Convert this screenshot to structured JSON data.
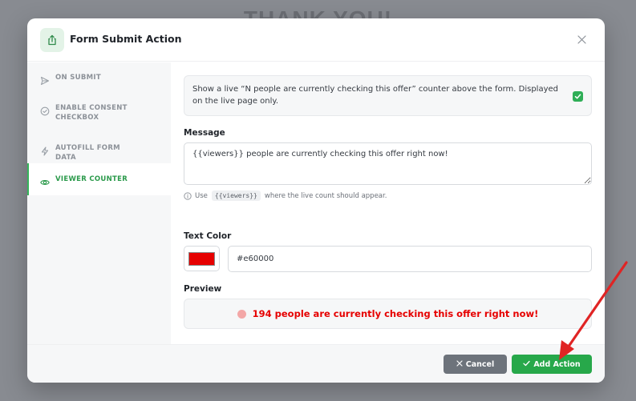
{
  "background": {
    "title": "THANK YOU!"
  },
  "modal": {
    "title": "Form Submit Action",
    "header_icon": "share-upload-icon",
    "close_icon": "close-icon"
  },
  "sidebar": {
    "items": [
      {
        "label": "On Submit",
        "icon": "send-icon",
        "active": false
      },
      {
        "label": "Enable Consent Checkbox",
        "icon": "check-circle-icon",
        "active": false
      },
      {
        "label": "Autofill Form Data",
        "icon": "bolt-icon",
        "active": false
      },
      {
        "label": "Viewer Counter",
        "icon": "eye-icon",
        "active": true
      }
    ]
  },
  "viewer_counter": {
    "description": "Show a live “N people are currently checking this offer” counter above the form. Displayed on the live page only.",
    "enabled": true,
    "message_label": "Message",
    "message_value": "{{viewers}} people are currently checking this offer right now!",
    "hint_prefix": "Use",
    "hint_code": "{{viewers}}",
    "hint_suffix": "where the live count should appear.",
    "text_color_label": "Text Color",
    "text_color_value": "#e60000",
    "preview_label": "Preview",
    "preview_text": "194 people are currently checking this offer right now!"
  },
  "footer": {
    "cancel_label": "Cancel",
    "add_label": "Add Action"
  },
  "colors": {
    "accent_green": "#27a84a",
    "counter_red": "#e60000",
    "annotation_arrow": "#e02424"
  }
}
